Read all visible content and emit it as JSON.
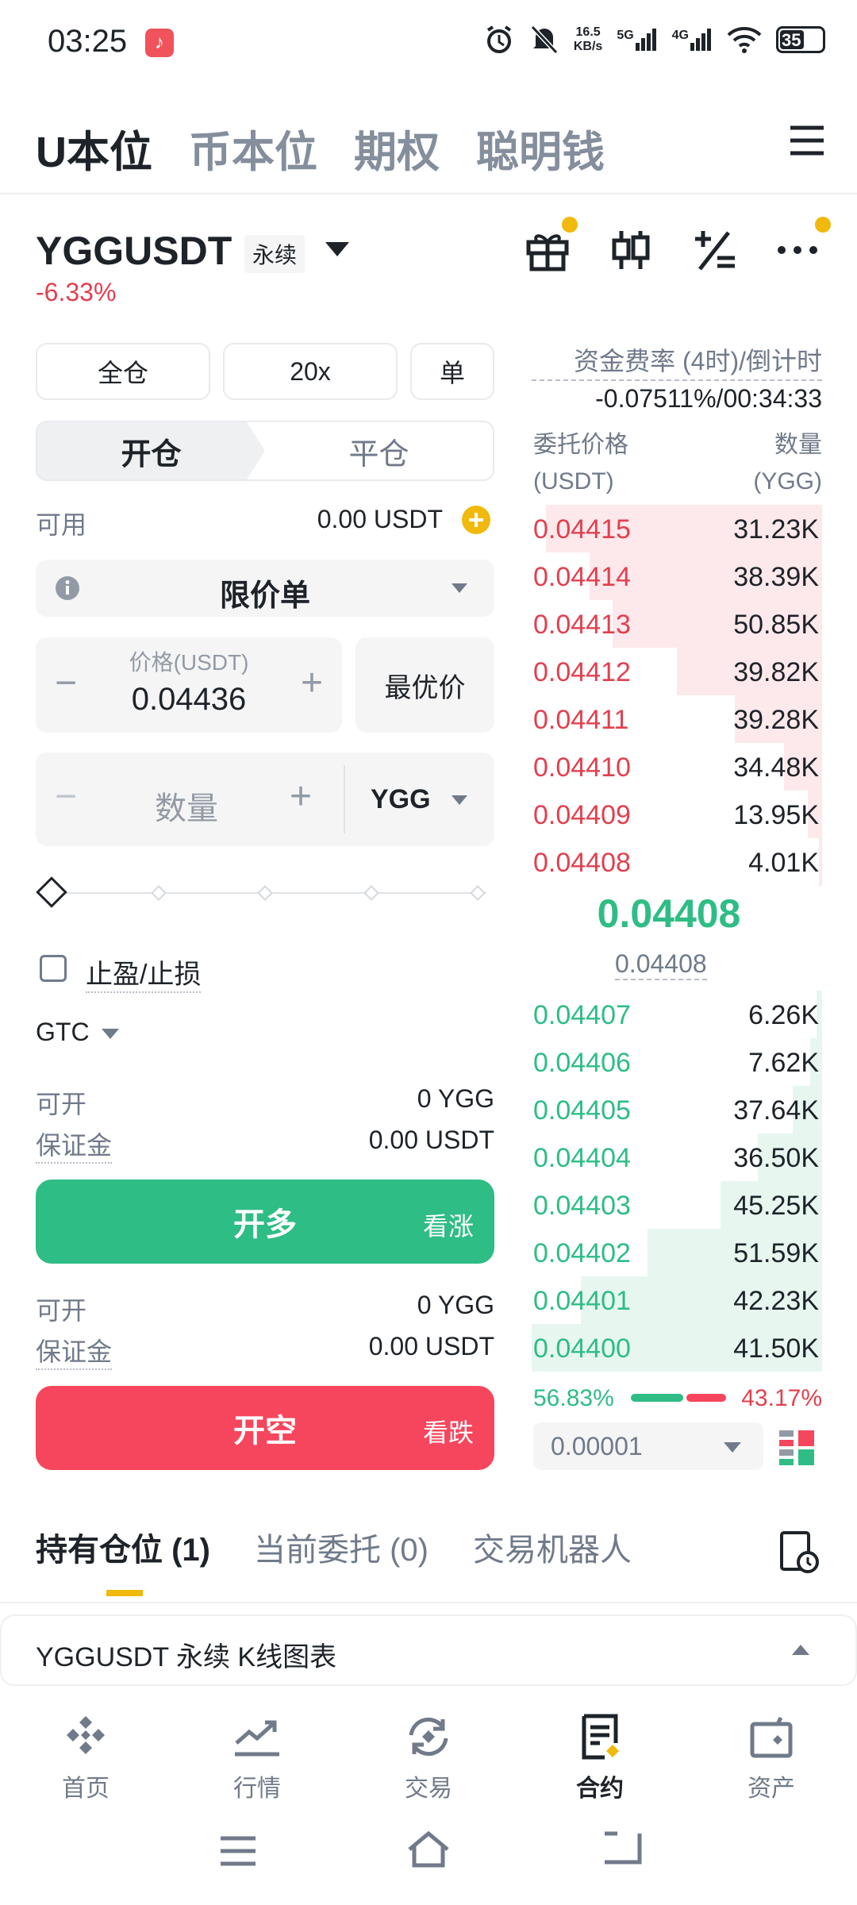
{
  "status_bar": {
    "time": "03:25",
    "net_speed_value": "16.5",
    "net_speed_unit": "KB/s",
    "signal1_label": "5G",
    "signal2_label": "4G",
    "battery": "35"
  },
  "top_tabs": [
    "U本位",
    "币本位",
    "期权",
    "聪明钱"
  ],
  "header": {
    "symbol": "YGGUSDT",
    "badge": "永续",
    "change": "-6.33%"
  },
  "controls": {
    "margin_mode": "全仓",
    "leverage": "20x",
    "position_mode": "单",
    "open_tab": "开仓",
    "close_tab": "平仓",
    "available_label": "可用",
    "available_value": "0.00 USDT",
    "order_type": "限价单",
    "price_label": "价格(USDT)",
    "price_value": "0.04436",
    "best_price": "最优价",
    "qty_placeholder": "数量",
    "qty_unit": "YGG",
    "tpsl_label": "止盈/止损",
    "tif": "GTC"
  },
  "long": {
    "can_open_label": "可开",
    "can_open_value": "0 YGG",
    "margin_label": "保证金",
    "margin_value": "0.00 USDT",
    "button": "开多",
    "button_side": "看涨"
  },
  "short": {
    "can_open_label": "可开",
    "can_open_value": "0 YGG",
    "margin_label": "保证金",
    "margin_value": "0.00 USDT",
    "button": "开空",
    "button_side": "看跌"
  },
  "orderbook": {
    "funding_label": "资金费率 (4时)/倒计时",
    "funding_value": "-0.07511%/00:34:33",
    "price_header": "委托价格",
    "price_unit": "(USDT)",
    "qty_header": "数量",
    "qty_unit": "(YGG)",
    "asks": [
      {
        "price": "0.04415",
        "qty": "31.23K",
        "depth": 0.95
      },
      {
        "price": "0.04414",
        "qty": "38.39K",
        "depth": 0.8
      },
      {
        "price": "0.04413",
        "qty": "50.85K",
        "depth": 0.72
      },
      {
        "price": "0.04412",
        "qty": "39.82K",
        "depth": 0.5
      },
      {
        "price": "0.04411",
        "qty": "39.28K",
        "depth": 0.3
      },
      {
        "price": "0.04410",
        "qty": "34.48K",
        "depth": 0.13
      },
      {
        "price": "0.04409",
        "qty": "13.95K",
        "depth": 0.05
      },
      {
        "price": "0.04408",
        "qty": "4.01K",
        "depth": 0.01
      }
    ],
    "last_price": "0.04408",
    "mark_price": "0.04408",
    "bids": [
      {
        "price": "0.04407",
        "qty": "6.26K",
        "depth": 0.02
      },
      {
        "price": "0.04406",
        "qty": "7.62K",
        "depth": 0.04
      },
      {
        "price": "0.04405",
        "qty": "37.64K",
        "depth": 0.1
      },
      {
        "price": "0.04404",
        "qty": "36.50K",
        "depth": 0.22
      },
      {
        "price": "0.04403",
        "qty": "45.25K",
        "depth": 0.35
      },
      {
        "price": "0.04402",
        "qty": "51.59K",
        "depth": 0.6
      },
      {
        "price": "0.04401",
        "qty": "42.23K",
        "depth": 0.83
      },
      {
        "price": "0.04400",
        "qty": "41.50K",
        "depth": 1.0
      }
    ],
    "bid_ratio": "56.83%",
    "ask_ratio": "43.17%",
    "precision": "0.00001"
  },
  "positions_tabs": [
    "持有仓位 (1)",
    "当前委托 (0)",
    "交易机器人"
  ],
  "kline_bar": "YGGUSDT 永续 K线图表",
  "bottom_nav": [
    "首页",
    "行情",
    "交易",
    "合约",
    "资产"
  ],
  "colors": {
    "green": "#2ebd85",
    "red": "#f6465d",
    "accent": "#f0b90b"
  }
}
